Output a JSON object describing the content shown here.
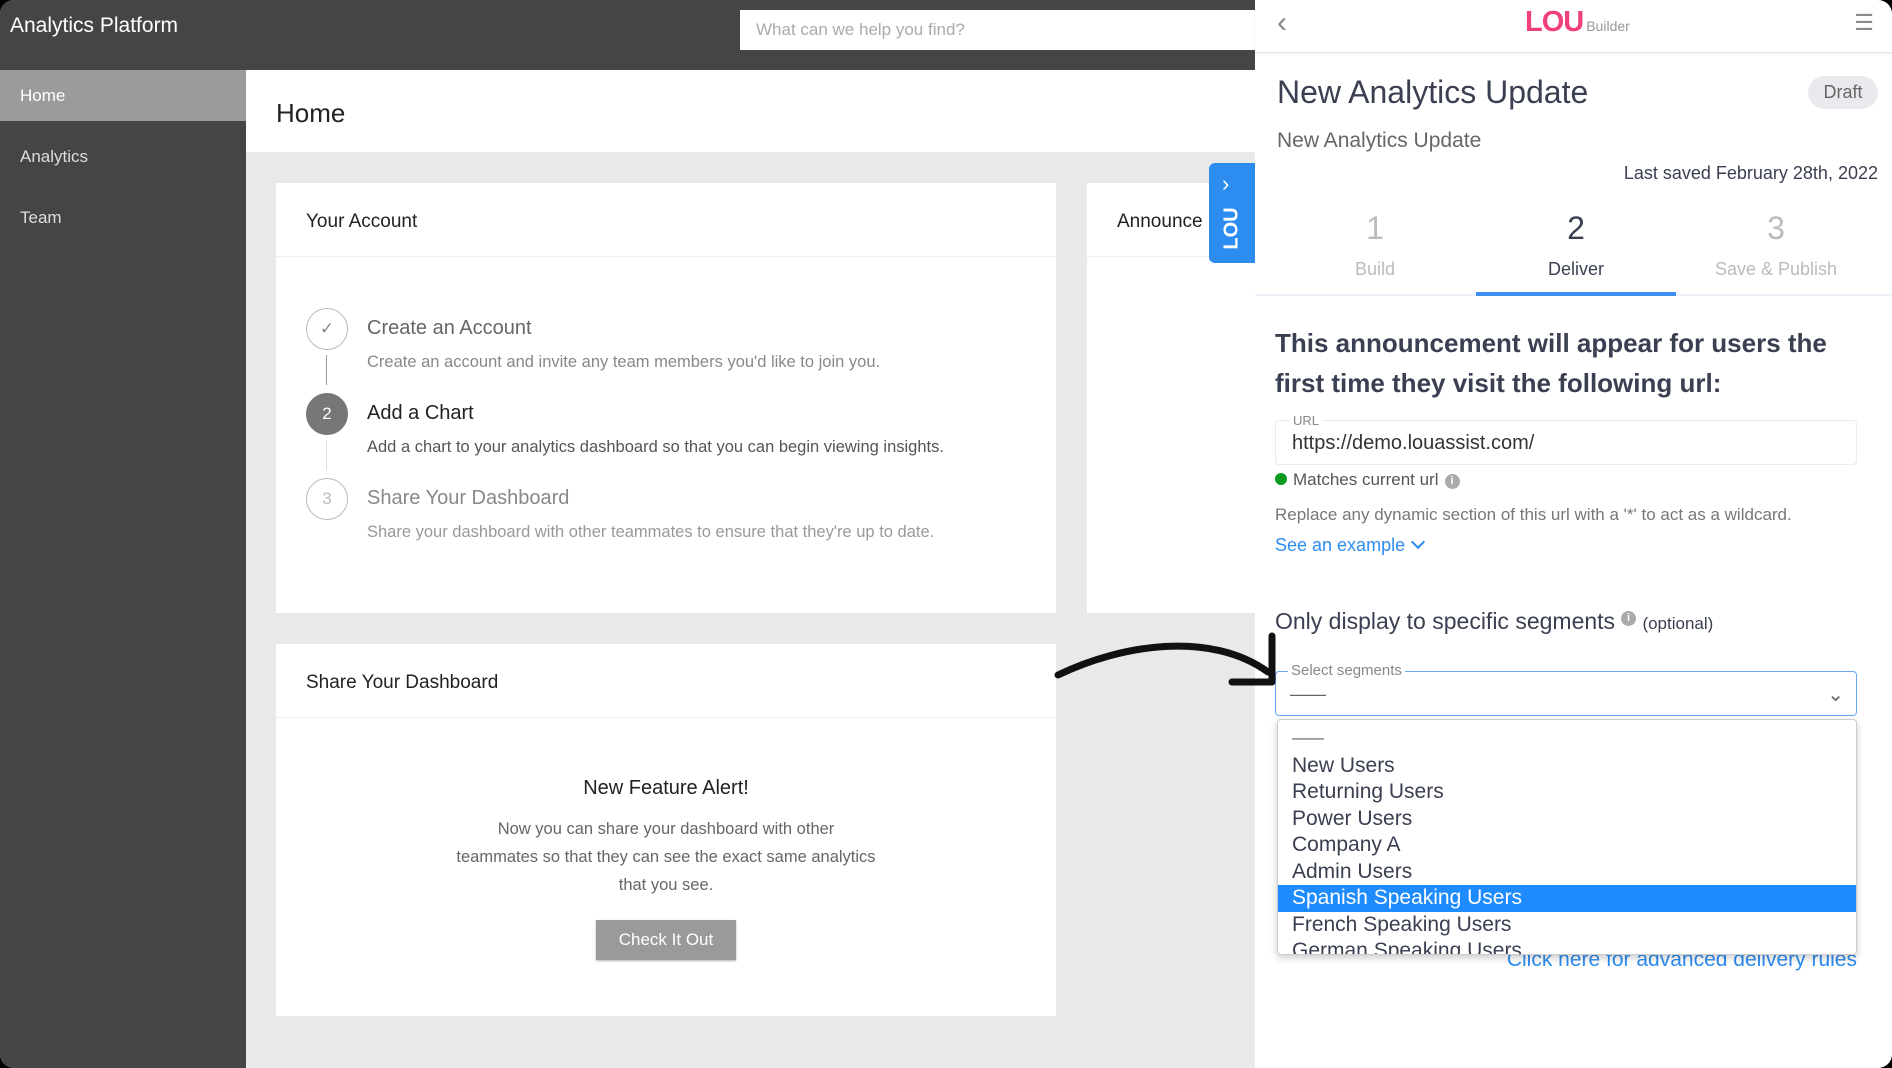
{
  "app": {
    "title": "Analytics Platform",
    "search_placeholder": "What can we help you find?"
  },
  "sidebar": {
    "items": [
      {
        "label": "Home",
        "active": true
      },
      {
        "label": "Analytics"
      },
      {
        "label": "Team"
      }
    ]
  },
  "main": {
    "title": "Home",
    "account_card": {
      "title": "Your Account",
      "steps": [
        {
          "marker": "✓",
          "title": "Create an Account",
          "desc": "Create an account and invite any team members you'd like to join you.",
          "state": "done"
        },
        {
          "marker": "2",
          "title": "Add a Chart",
          "desc": "Add a chart to your analytics dashboard so that you can begin viewing insights.",
          "state": "active"
        },
        {
          "marker": "3",
          "title": "Share Your Dashboard",
          "desc": "Share your dashboard with other teammates to ensure that they're up to date.",
          "state": "pending"
        }
      ]
    },
    "announce_card": {
      "title": "Announce"
    },
    "share_card": {
      "title": "Share Your Dashboard",
      "feature_title": "New Feature Alert!",
      "feature_lines": [
        "Now you can share your dashboard with other",
        "teammates so that they can see the exact same analytics",
        "that you see."
      ],
      "button": "Check It Out"
    }
  },
  "lou_tab": {
    "label": "LOU",
    "icon": "chevron-right-icon",
    "color": "#2d8cf0"
  },
  "panel": {
    "logo": "LOU",
    "logo_sub": "Builder",
    "title": "New Analytics Update",
    "status": "Draft",
    "subtitle": "New Analytics Update",
    "last_saved": "Last saved February 28th, 2022",
    "steps": [
      {
        "num": "1",
        "label": "Build"
      },
      {
        "num": "2",
        "label": "Deliver",
        "active": true
      },
      {
        "num": "3",
        "label": "Save & Publish"
      }
    ],
    "heading": "This announcement will appear for users the first time they visit the following url:",
    "url_label": "URL",
    "url_value": "https://demo.louassist.com/",
    "match_text": "Matches current url",
    "match_color": "#0a9b1e",
    "replace_text": "Replace any dynamic section of this url with a '*' to act as a wildcard.",
    "example_link": "See an example",
    "segments_heading": "Only display to specific segments",
    "segments_optional": "(optional)",
    "select_label": "Select segments",
    "select_value": "——",
    "options": [
      "——",
      "New Users",
      "Returning Users",
      "Power Users",
      "Company A",
      "Admin Users",
      "Spanish Speaking Users",
      "French Speaking Users",
      "German Speaking Users"
    ],
    "highlighted_option": "Spanish Speaking Users",
    "advanced_link": "Click here for advanced delivery rules",
    "accent": "#2d8cf0"
  }
}
